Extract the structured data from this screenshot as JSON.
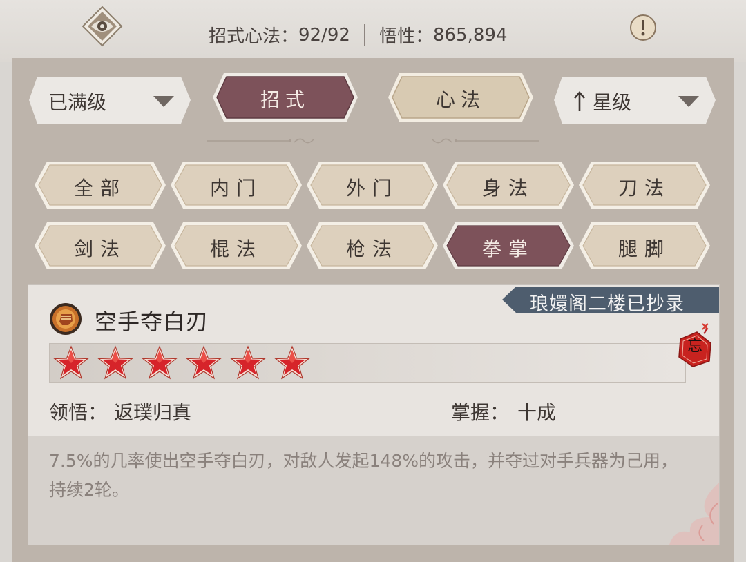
{
  "header": {
    "stats_label": "招式心法：",
    "stats_value": "92/92",
    "insight_label": "悟性：",
    "insight_value": "865,894",
    "eye_icon": "eye-icon",
    "info_icon": "exclamation-icon"
  },
  "filters": {
    "level_dropdown": "已满级",
    "sort_dropdown": "星级",
    "sort_icon": "arrow-up-icon"
  },
  "tabs": [
    {
      "label": "招式",
      "active": true
    },
    {
      "label": "心法",
      "active": false
    }
  ],
  "categories": [
    {
      "label": "全部",
      "active": false
    },
    {
      "label": "内门",
      "active": false
    },
    {
      "label": "外门",
      "active": false
    },
    {
      "label": "身法",
      "active": false
    },
    {
      "label": "刀法",
      "active": false
    },
    {
      "label": "剑法",
      "active": false
    },
    {
      "label": "棍法",
      "active": false
    },
    {
      "label": "枪法",
      "active": false
    },
    {
      "label": "拳掌",
      "active": true
    },
    {
      "label": "腿脚",
      "active": false
    }
  ],
  "skill": {
    "banner": "琅嬛阁二楼已抄录",
    "name": "空手夺白刃",
    "stars": 6,
    "seal_text": "忘",
    "comprehension_label": "领悟：",
    "comprehension_value": "返璞归真",
    "mastery_label": "掌握：",
    "mastery_value": "十成",
    "description": "7.5%的几率使出空手夺白刃，对敌人发起148%的攻击，并夺过对手兵器为己用，持续2轮。"
  },
  "colors": {
    "accent_active": "#7d525a",
    "chip_fill": "#ddd0bd",
    "panel": "#bdb4ab",
    "banner": "#4e5d6e",
    "star_red": "#d6242a"
  }
}
